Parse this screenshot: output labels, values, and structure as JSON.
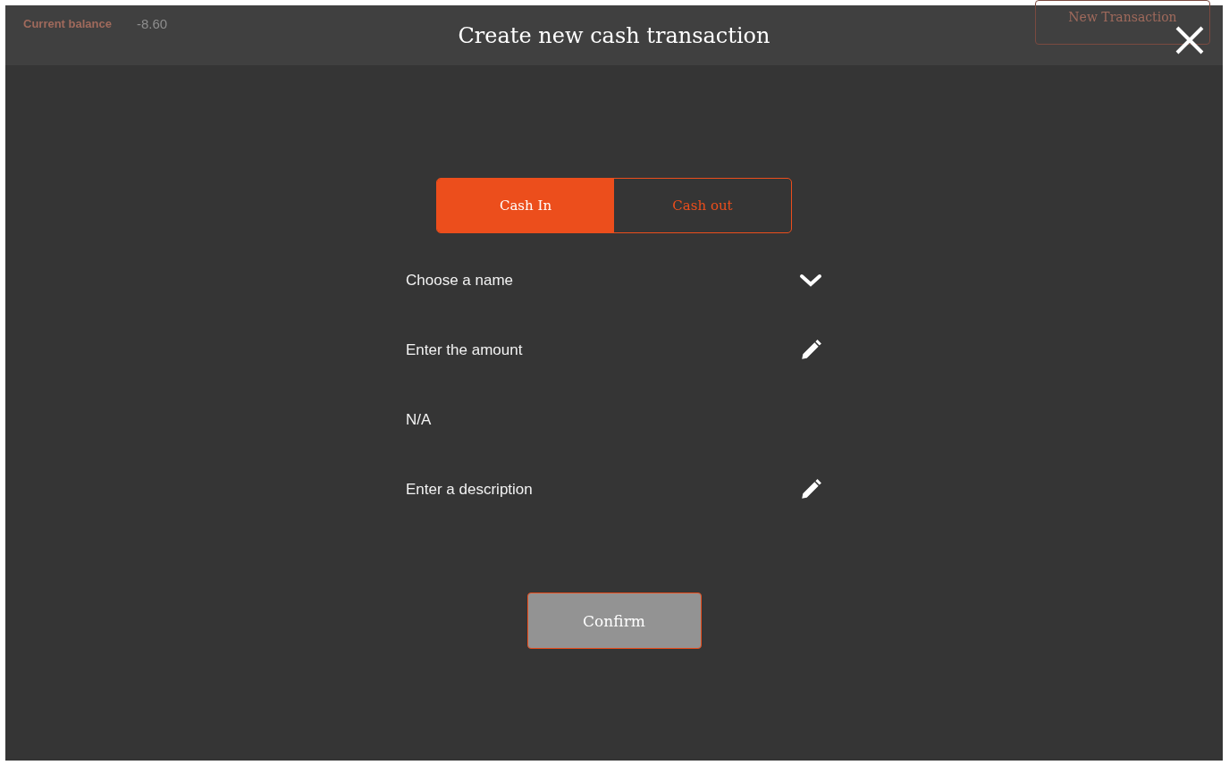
{
  "background": {
    "balance_label": "Current balance",
    "balance_value": "-8.60",
    "new_button": "New Transaction"
  },
  "dialog": {
    "title": "Create new cash transaction",
    "tabs": [
      {
        "label": "Cash In",
        "selected": true
      },
      {
        "label": "Cash out",
        "selected": false
      }
    ],
    "fields": [
      {
        "kind": "dropdown",
        "placeholder": "Choose a name"
      },
      {
        "kind": "edit",
        "placeholder": "Enter the amount"
      },
      {
        "kind": "text",
        "placeholder": "N/A"
      },
      {
        "kind": "edit",
        "placeholder": "Enter a description"
      }
    ],
    "confirm": {
      "label": "Confirm",
      "disabled": true
    }
  }
}
